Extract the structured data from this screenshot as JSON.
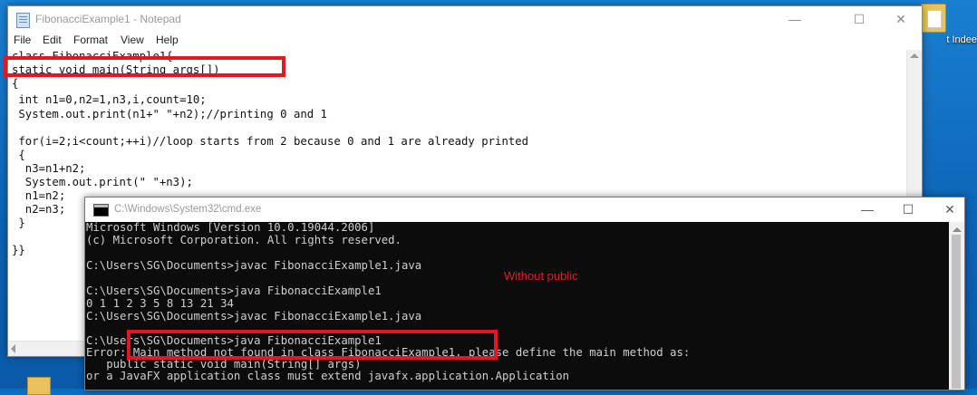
{
  "desktop": {
    "icon_label": "t Indee"
  },
  "notepad": {
    "title": "FibonacciExample1 - Notepad",
    "menu": [
      "File",
      "Edit",
      "Format",
      "View",
      "Help"
    ],
    "lines": [
      "class FibonacciExample1{",
      "static void main(String args[])",
      "{",
      " int n1=0,n2=1,n3,i,count=10;",
      " System.out.print(n1+\" \"+n2);//printing 0 and 1",
      "",
      " for(i=2;i<count;++i)//loop starts from 2 because 0 and 1 are already printed",
      " {",
      "  n3=n1+n2;",
      "  System.out.print(\" \"+n3);",
      "  n1=n2;",
      "  n2=n3;",
      " }",
      "",
      "}}"
    ]
  },
  "cmd": {
    "title": "C:\\Windows\\System32\\cmd.exe",
    "annotation": "Without public",
    "lines": [
      "Microsoft Windows [Version 10.0.19044.2006]",
      "(c) Microsoft Corporation. All rights reserved.",
      "",
      "C:\\Users\\SG\\Documents>javac FibonacciExample1.java",
      "",
      "C:\\Users\\SG\\Documents>java FibonacciExample1",
      "0 1 1 2 3 5 8 13 21 34",
      "C:\\Users\\SG\\Documents>javac FibonacciExample1.java",
      "",
      "C:\\Users\\SG\\Documents>java FibonacciExample1",
      "Error: Main method not found in class FibonacciExample1, please define the main method as:",
      "   public static void main(String[] args)",
      "or a JavaFX application class must extend javafx.application.Application"
    ]
  },
  "window_controls": {
    "minimize": "—",
    "maximize": "☐",
    "close": "✕"
  },
  "colors": {
    "highlight": "#e0191f",
    "annotation": "#e02020"
  }
}
